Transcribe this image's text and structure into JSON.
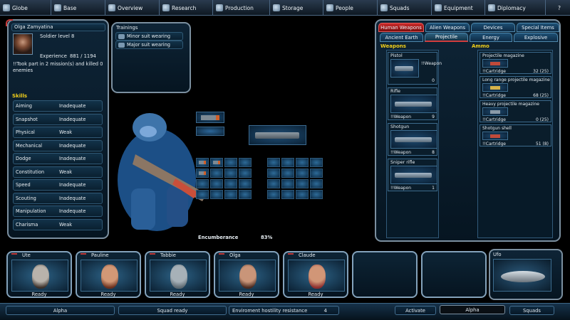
{
  "topbar": {
    "items": [
      {
        "label": "Globe",
        "icon": "globe-icon"
      },
      {
        "label": "Base",
        "icon": "base-icon"
      },
      {
        "label": "Overview",
        "icon": "overview-icon"
      },
      {
        "label": "Research",
        "icon": "research-icon"
      },
      {
        "label": "Production",
        "icon": "production-icon"
      },
      {
        "label": "Storage",
        "icon": "storage-icon"
      },
      {
        "label": "People",
        "icon": "people-icon"
      },
      {
        "label": "Squads",
        "icon": "squads-icon"
      },
      {
        "label": "Equipment",
        "icon": "equipment-icon"
      },
      {
        "label": "Diplomacy",
        "icon": "diplomacy-icon"
      }
    ],
    "help": "?"
  },
  "soldier": {
    "name": "Olga Zamyatina",
    "rank": "Soldier level 8",
    "experience_label": "Experience",
    "experience": "881 / 1194",
    "note": "!!Took part in 2 mission(s) and killed 0 enemies"
  },
  "skills": {
    "title": "Skills",
    "items": [
      {
        "name": "Aiming",
        "value": "Inadequate"
      },
      {
        "name": "Snapshot",
        "value": "Inadequate"
      },
      {
        "name": "Physical",
        "value": "Weak"
      },
      {
        "name": "Mechanical",
        "value": "Inadequate"
      },
      {
        "name": "Dodge",
        "value": "Inadequate"
      },
      {
        "name": "Constitution",
        "value": "Weak"
      },
      {
        "name": "Speed",
        "value": "Inadequate"
      },
      {
        "name": "Scouting",
        "value": "Inadequate"
      },
      {
        "name": "Manipulation",
        "value": "Inadequate"
      },
      {
        "name": "Charisma",
        "value": "Weak"
      }
    ]
  },
  "trainings": {
    "title": "Trainings",
    "items": [
      "Minor suit wearing",
      "Major suit wearing"
    ]
  },
  "encumbrance": {
    "label": "Encumberance",
    "value": "83%"
  },
  "inventory": {
    "categories": [
      "Human Weapons",
      "Alien Weapons",
      "Devices",
      "Special Items"
    ],
    "subtabs": [
      "Ancient Earth",
      "Projectile",
      "Energy",
      "Explosive"
    ],
    "weapons_title": "Weapons",
    "ammo_title": "Ammo",
    "weapons": [
      {
        "name": "Pistol",
        "tag": "!!Weapon",
        "count": "0"
      },
      {
        "name": "Rifle",
        "tag": "!!Weapon",
        "count": "9"
      },
      {
        "name": "Shotgun",
        "tag": "!!Weapon",
        "count": "8"
      },
      {
        "name": "Sniper rifle",
        "tag": "!!Weapon",
        "count": "1"
      }
    ],
    "ammo": [
      {
        "name": "Projectile magazine",
        "tag": "!!Cartridge",
        "count": "32 (25)"
      },
      {
        "name": "Long range projectile magazine",
        "tag": "!!Cartridge",
        "count": "68 (25)"
      },
      {
        "name": "Heavy projectile magazine",
        "tag": "!!Cartridge",
        "count": "0 (25)"
      },
      {
        "name": "Shotgun shell",
        "tag": "!!Cartridge",
        "count": "51 (8)"
      }
    ]
  },
  "squad": [
    {
      "name": "Ute",
      "status": "Ready"
    },
    {
      "name": "Pauline",
      "status": "Ready"
    },
    {
      "name": "Tabbie",
      "status": "Ready"
    },
    {
      "name": "Olga",
      "status": "Ready"
    },
    {
      "name": "Claude",
      "status": "Ready"
    }
  ],
  "ufo": {
    "label": "Ufo"
  },
  "bottom": {
    "squad_name": "Alpha",
    "squad_status": "Squad ready",
    "hostility_label": "Enviroment hostility resistance",
    "hostility_value": "4",
    "activate": "Activate",
    "selected": "Alpha",
    "squads_button": "Squads"
  },
  "colors": {
    "accent": "#f1cf1a",
    "panel_border": "#7b8f9f",
    "tab_active": "#cb2a2a"
  }
}
